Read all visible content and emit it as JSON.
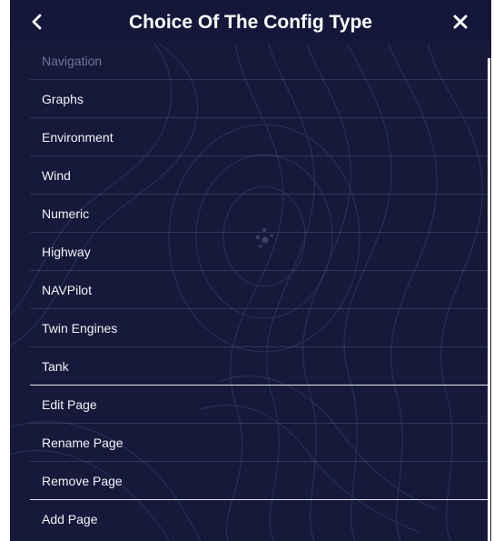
{
  "header": {
    "title": "Choice Of The Config Type",
    "back_icon": "chevron-left-icon",
    "close_icon": "close-icon"
  },
  "menu": {
    "items": [
      {
        "label": "Navigation",
        "enabled": false
      },
      {
        "label": "Graphs",
        "enabled": true
      },
      {
        "label": "Environment",
        "enabled": true
      },
      {
        "label": "Wind",
        "enabled": true
      },
      {
        "label": "Numeric",
        "enabled": true
      },
      {
        "label": "Highway",
        "enabled": true
      },
      {
        "label": "NAVPilot",
        "enabled": true
      },
      {
        "label": "Twin Engines",
        "enabled": true
      },
      {
        "label": "Tank",
        "enabled": true
      }
    ],
    "page_actions": [
      {
        "label": "Edit Page"
      },
      {
        "label": "Rename Page"
      },
      {
        "label": "Remove Page"
      }
    ],
    "add_action": {
      "label": "Add Page"
    }
  },
  "colors": {
    "background": "#16193a",
    "text": "#f2f3f8",
    "disabled_text": "#6f7496",
    "separator": "#e6e8f2"
  }
}
